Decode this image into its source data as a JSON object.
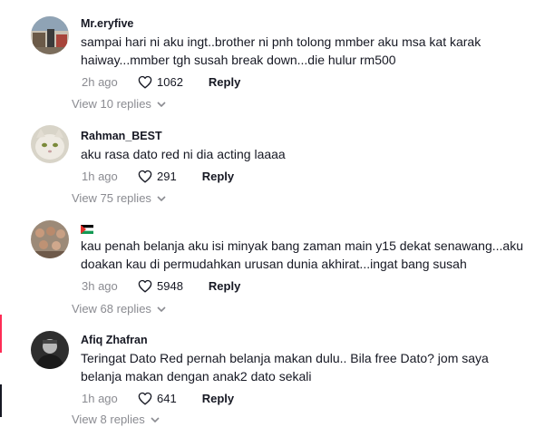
{
  "comments": [
    {
      "username": "Mr.eryfive",
      "text": "sampai hari ni aku ingt..brother ni pnh tolong mmber aku msa kat karak haiway...mmber tgh susah break down...die hulur rm500",
      "time": "2h ago",
      "likes": "1062",
      "reply_label": "Reply",
      "view_replies": "View 10 replies"
    },
    {
      "username": "Rahman_BEST",
      "text": "aku rasa dato red ni dia acting laaaa",
      "time": "1h ago",
      "likes": "291",
      "reply_label": "Reply",
      "view_replies": "View 75 replies"
    },
    {
      "username": "",
      "username_icon": "palestine-flag-icon",
      "text": "kau penah belanja aku isi minyak bang zaman main y15 dekat senawang...aku doakan kau di permudahkan urusan dunia akhirat...ingat bang susah",
      "time": "3h ago",
      "likes": "5948",
      "reply_label": "Reply",
      "view_replies": "View 68 replies"
    },
    {
      "username": "Afiq Zhafran",
      "text": "Teringat Dato Red pernah belanja makan dulu.. Bila free Dato? jom saya belanja makan dengan anak2 dato sekali",
      "time": "1h ago",
      "likes": "641",
      "reply_label": "Reply",
      "view_replies": "View 8 replies"
    }
  ],
  "icons": {
    "like": "heart-outline-icon",
    "expand": "chevron-down-icon"
  },
  "colors": {
    "primary_text": "#161823",
    "secondary_text": "#8a8b91",
    "accent": "#fe2c55"
  }
}
